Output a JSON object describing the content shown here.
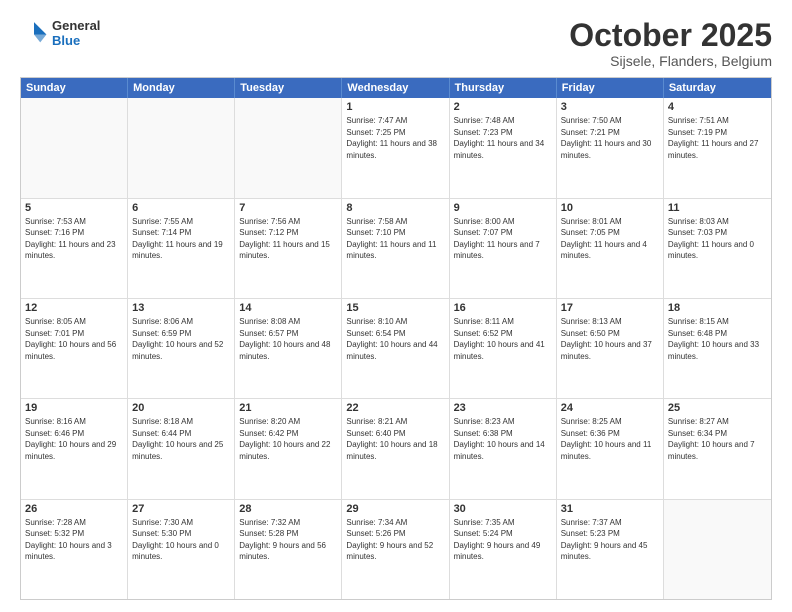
{
  "header": {
    "logo": {
      "general": "General",
      "blue": "Blue"
    },
    "title": "October 2025",
    "location": "Sijsele, Flanders, Belgium"
  },
  "calendar": {
    "days_of_week": [
      "Sunday",
      "Monday",
      "Tuesday",
      "Wednesday",
      "Thursday",
      "Friday",
      "Saturday"
    ],
    "rows": [
      [
        {
          "day": "",
          "empty": true
        },
        {
          "day": "",
          "empty": true
        },
        {
          "day": "",
          "empty": true
        },
        {
          "day": "1",
          "sunrise": "7:47 AM",
          "sunset": "7:25 PM",
          "daylight": "11 hours and 38 minutes."
        },
        {
          "day": "2",
          "sunrise": "7:48 AM",
          "sunset": "7:23 PM",
          "daylight": "11 hours and 34 minutes."
        },
        {
          "day": "3",
          "sunrise": "7:50 AM",
          "sunset": "7:21 PM",
          "daylight": "11 hours and 30 minutes."
        },
        {
          "day": "4",
          "sunrise": "7:51 AM",
          "sunset": "7:19 PM",
          "daylight": "11 hours and 27 minutes."
        }
      ],
      [
        {
          "day": "5",
          "sunrise": "7:53 AM",
          "sunset": "7:16 PM",
          "daylight": "11 hours and 23 minutes."
        },
        {
          "day": "6",
          "sunrise": "7:55 AM",
          "sunset": "7:14 PM",
          "daylight": "11 hours and 19 minutes."
        },
        {
          "day": "7",
          "sunrise": "7:56 AM",
          "sunset": "7:12 PM",
          "daylight": "11 hours and 15 minutes."
        },
        {
          "day": "8",
          "sunrise": "7:58 AM",
          "sunset": "7:10 PM",
          "daylight": "11 hours and 11 minutes."
        },
        {
          "day": "9",
          "sunrise": "8:00 AM",
          "sunset": "7:07 PM",
          "daylight": "11 hours and 7 minutes."
        },
        {
          "day": "10",
          "sunrise": "8:01 AM",
          "sunset": "7:05 PM",
          "daylight": "11 hours and 4 minutes."
        },
        {
          "day": "11",
          "sunrise": "8:03 AM",
          "sunset": "7:03 PM",
          "daylight": "11 hours and 0 minutes."
        }
      ],
      [
        {
          "day": "12",
          "sunrise": "8:05 AM",
          "sunset": "7:01 PM",
          "daylight": "10 hours and 56 minutes."
        },
        {
          "day": "13",
          "sunrise": "8:06 AM",
          "sunset": "6:59 PM",
          "daylight": "10 hours and 52 minutes."
        },
        {
          "day": "14",
          "sunrise": "8:08 AM",
          "sunset": "6:57 PM",
          "daylight": "10 hours and 48 minutes."
        },
        {
          "day": "15",
          "sunrise": "8:10 AM",
          "sunset": "6:54 PM",
          "daylight": "10 hours and 44 minutes."
        },
        {
          "day": "16",
          "sunrise": "8:11 AM",
          "sunset": "6:52 PM",
          "daylight": "10 hours and 41 minutes."
        },
        {
          "day": "17",
          "sunrise": "8:13 AM",
          "sunset": "6:50 PM",
          "daylight": "10 hours and 37 minutes."
        },
        {
          "day": "18",
          "sunrise": "8:15 AM",
          "sunset": "6:48 PM",
          "daylight": "10 hours and 33 minutes."
        }
      ],
      [
        {
          "day": "19",
          "sunrise": "8:16 AM",
          "sunset": "6:46 PM",
          "daylight": "10 hours and 29 minutes."
        },
        {
          "day": "20",
          "sunrise": "8:18 AM",
          "sunset": "6:44 PM",
          "daylight": "10 hours and 25 minutes."
        },
        {
          "day": "21",
          "sunrise": "8:20 AM",
          "sunset": "6:42 PM",
          "daylight": "10 hours and 22 minutes."
        },
        {
          "day": "22",
          "sunrise": "8:21 AM",
          "sunset": "6:40 PM",
          "daylight": "10 hours and 18 minutes."
        },
        {
          "day": "23",
          "sunrise": "8:23 AM",
          "sunset": "6:38 PM",
          "daylight": "10 hours and 14 minutes."
        },
        {
          "day": "24",
          "sunrise": "8:25 AM",
          "sunset": "6:36 PM",
          "daylight": "10 hours and 11 minutes."
        },
        {
          "day": "25",
          "sunrise": "8:27 AM",
          "sunset": "6:34 PM",
          "daylight": "10 hours and 7 minutes."
        }
      ],
      [
        {
          "day": "26",
          "sunrise": "7:28 AM",
          "sunset": "5:32 PM",
          "daylight": "10 hours and 3 minutes."
        },
        {
          "day": "27",
          "sunrise": "7:30 AM",
          "sunset": "5:30 PM",
          "daylight": "10 hours and 0 minutes."
        },
        {
          "day": "28",
          "sunrise": "7:32 AM",
          "sunset": "5:28 PM",
          "daylight": "9 hours and 56 minutes."
        },
        {
          "day": "29",
          "sunrise": "7:34 AM",
          "sunset": "5:26 PM",
          "daylight": "9 hours and 52 minutes."
        },
        {
          "day": "30",
          "sunrise": "7:35 AM",
          "sunset": "5:24 PM",
          "daylight": "9 hours and 49 minutes."
        },
        {
          "day": "31",
          "sunrise": "7:37 AM",
          "sunset": "5:23 PM",
          "daylight": "9 hours and 45 minutes."
        },
        {
          "day": "",
          "empty": true
        }
      ]
    ]
  }
}
